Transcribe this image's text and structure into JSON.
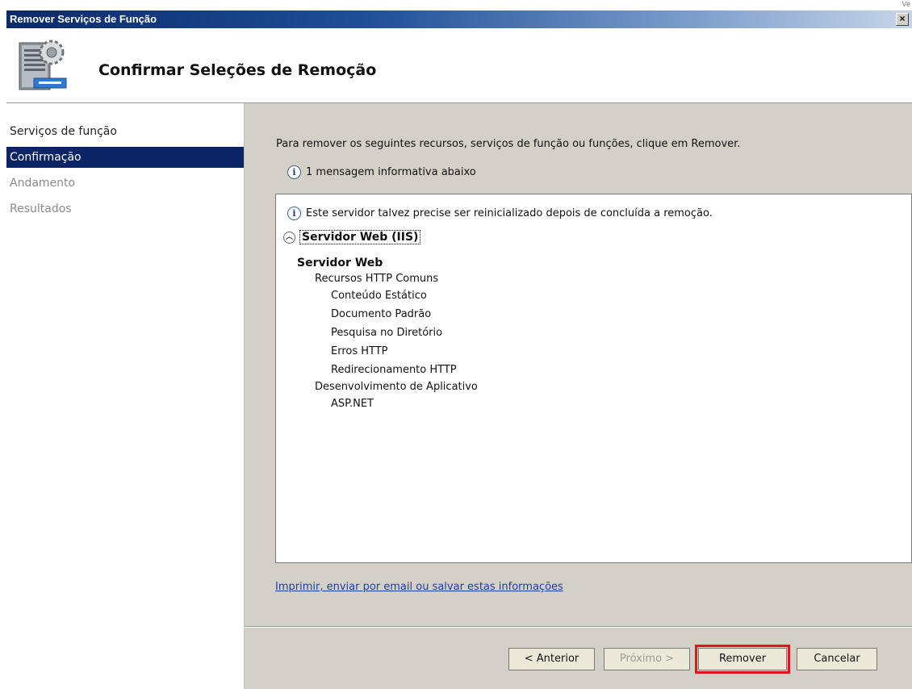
{
  "window": {
    "title": "Remover Serviços de Função",
    "close_symbol": "×",
    "corner_text": "Ve"
  },
  "header": {
    "title": "Confirmar Seleções de Remoção",
    "icon": "server-gear-icon"
  },
  "sidebar": {
    "items": [
      {
        "label": "Serviços de função"
      },
      {
        "label": "Confirmação"
      },
      {
        "label": "Andamento"
      },
      {
        "label": "Resultados"
      }
    ]
  },
  "main": {
    "intro": "Para remover os seguintes recursos, serviços de função ou funções, clique em Remover.",
    "info_count_text": "1 mensagem informativa abaixo",
    "info_message": "Este servidor talvez precise ser reinicializado depois de concluída a remoção.",
    "section_title": "Servidor Web (IIS)",
    "tree": {
      "root": "Servidor Web",
      "group1": "Recursos HTTP Comuns",
      "group1_items": [
        "Conteúdo Estático",
        "Documento Padrão",
        "Pesquisa no Diretório",
        "Erros HTTP",
        "Redirecionamento HTTP"
      ],
      "group2": "Desenvolvimento de Aplicativo",
      "group2_items": [
        "ASP.NET"
      ]
    },
    "link": "Imprimir, enviar por email ou salvar estas informações"
  },
  "buttons": {
    "previous": "< Anterior",
    "next": "Próximo >",
    "remove": "Remover",
    "cancel": "Cancelar"
  },
  "colors": {
    "selected_sidebar": "#0b2466",
    "highlight": "#e0141a",
    "link": "#1a3fa8"
  }
}
